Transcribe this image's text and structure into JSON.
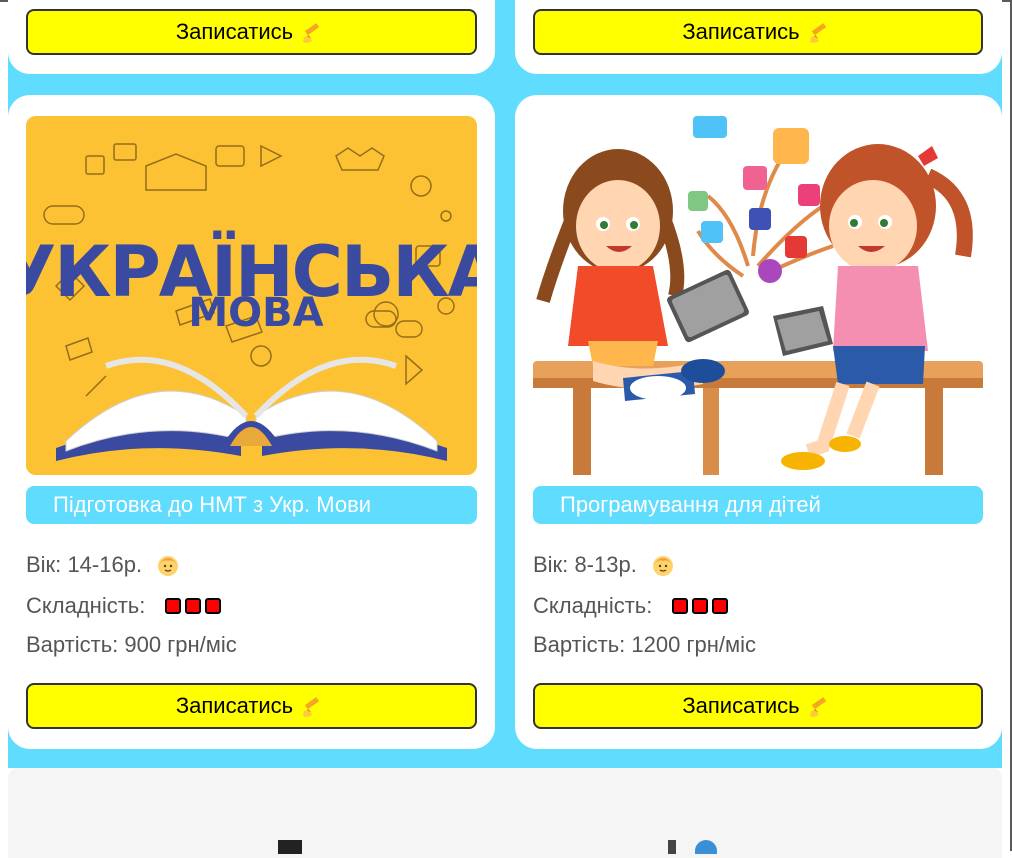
{
  "cards_top": [
    {
      "button_label": "Записатись"
    },
    {
      "button_label": "Записатись"
    }
  ],
  "cards": [
    {
      "image_title_line1": "УКРАЇНСЬКА",
      "image_title_line2": "МОВА",
      "title": "Підготовка до НМТ з Укр. Мови",
      "age_label": "Вік:",
      "age_value": "14-16р.",
      "difficulty_label": "Складність:",
      "difficulty_level": 3,
      "price_label": "Вартість:",
      "price_value": "900 грн/міс",
      "button_label": "Записатись",
      "age_icon": "child-face-icon"
    },
    {
      "title": "Програмування для дітей",
      "age_label": "Вік:",
      "age_value": "8-13р.",
      "difficulty_label": "Складність:",
      "difficulty_level": 3,
      "price_label": "Вартість:",
      "price_value": "1200 грн/міс",
      "button_label": "Записатись",
      "age_icon": "child-face-icon"
    }
  ],
  "colors": {
    "section_bg": "#5fdcfe",
    "button_bg": "#ffff00",
    "difficulty_dot": "#ff0000",
    "ukr_image_bg": "#fcc233",
    "ukr_title_color": "#3a4aa0"
  }
}
